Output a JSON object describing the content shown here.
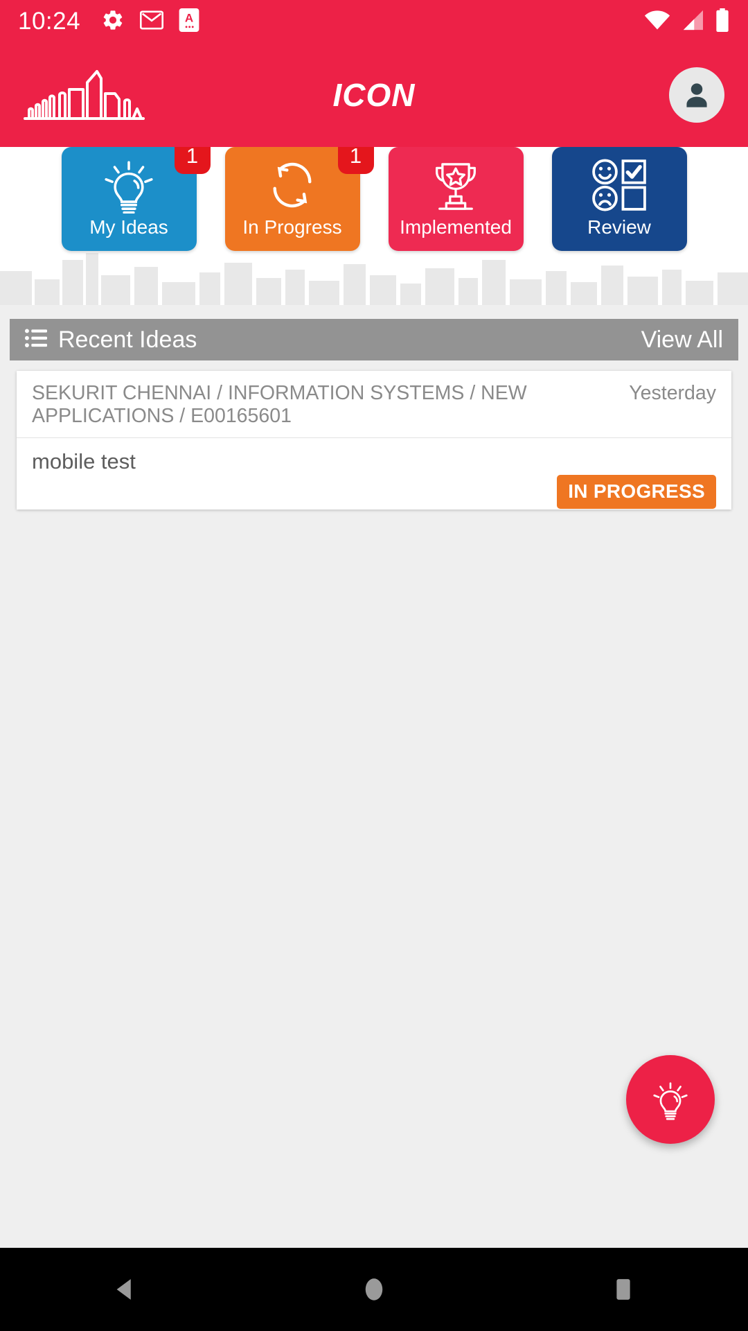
{
  "statusbar": {
    "time": "10:24",
    "left_icons": [
      "gear-icon",
      "gmail-icon",
      "app-letter-a-icon"
    ],
    "right_icons": [
      "wifi-icon",
      "cellular-signal-icon",
      "battery-icon"
    ]
  },
  "header": {
    "title": "ICON",
    "logo": "city-skyline-logo",
    "avatar": "user-avatar-icon",
    "background_color": "#ED2147"
  },
  "tiles": [
    {
      "label": "My Ideas",
      "icon": "lightbulb-icon",
      "badge": "1",
      "color": "#1C8FC9"
    },
    {
      "label": "In Progress",
      "icon": "refresh-sync-icon",
      "badge": "1",
      "color": "#EF7622"
    },
    {
      "label": "Implemented",
      "icon": "trophy-star-icon",
      "badge": "",
      "color": "#EE2A52"
    },
    {
      "label": "Review",
      "icon": "faces-checkboxes-icon",
      "badge": "",
      "color": "#16478C"
    }
  ],
  "recent": {
    "title": "Recent Ideas",
    "list_icon": "list-bullets-icon",
    "view_all": "View All",
    "bar_color": "#939393"
  },
  "ideas": [
    {
      "path": "SEKURIT CHENNAI / INFORMATION SYSTEMS / NEW APPLICATIONS / E00165601",
      "date": "Yesterday",
      "subject": "mobile test",
      "status": "IN PROGRESS",
      "status_color": "#EF7622"
    }
  ],
  "fab": {
    "icon": "lightbulb-icon",
    "color": "#ED2147"
  },
  "navbar": {
    "back": "back-triangle-icon",
    "home": "home-circle-icon",
    "recents": "recents-square-icon"
  }
}
